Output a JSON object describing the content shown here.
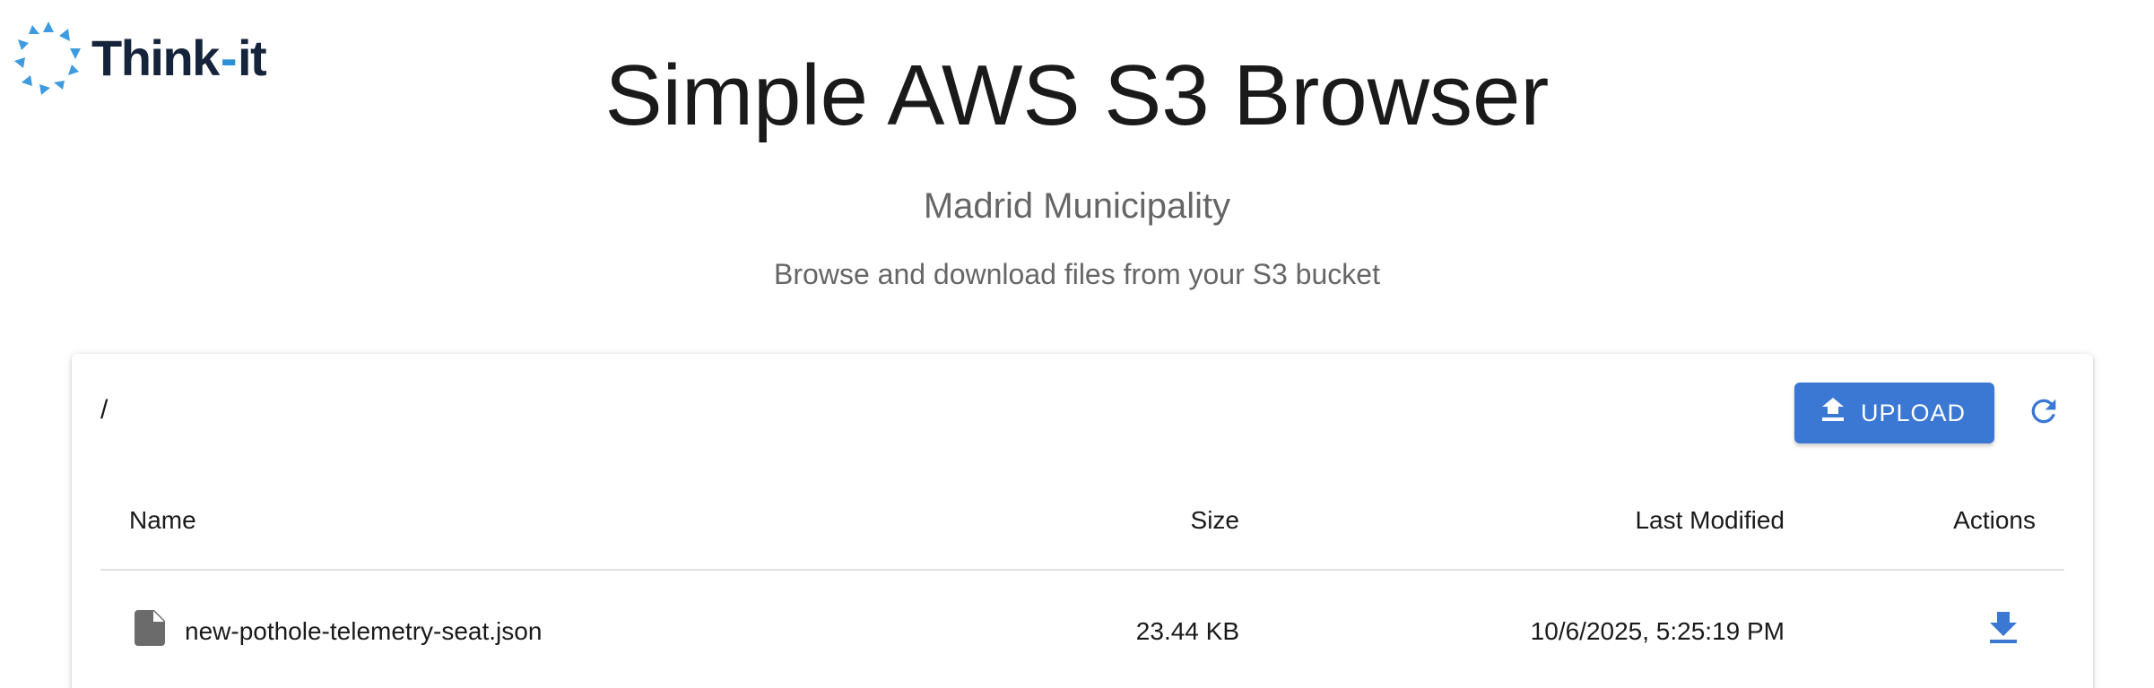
{
  "brand": {
    "logo_text_left": "Think",
    "logo_text_sep": "-",
    "logo_text_right": "it",
    "logo_icon": "think-it-star-icon",
    "brand_color": "#15243b",
    "accent_color": "#2d8fd5"
  },
  "header": {
    "title": "Simple AWS S3 Browser",
    "organization": "Madrid Municipality",
    "subtitle": "Browse and download files from your S3 bucket"
  },
  "browser": {
    "current_path": "/",
    "upload_label": "UPLOAD",
    "upload_icon": "upload-icon",
    "refresh_icon": "refresh-icon",
    "primary_color": "#3a78d4"
  },
  "table": {
    "columns": {
      "name": "Name",
      "size": "Size",
      "last_modified": "Last Modified",
      "actions": "Actions"
    },
    "rows": [
      {
        "icon": "file-icon",
        "name": "new-pothole-telemetry-seat.json",
        "size": "23.44 KB",
        "last_modified": "10/6/2025, 5:25:19 PM",
        "action_icon": "download-icon"
      }
    ]
  }
}
